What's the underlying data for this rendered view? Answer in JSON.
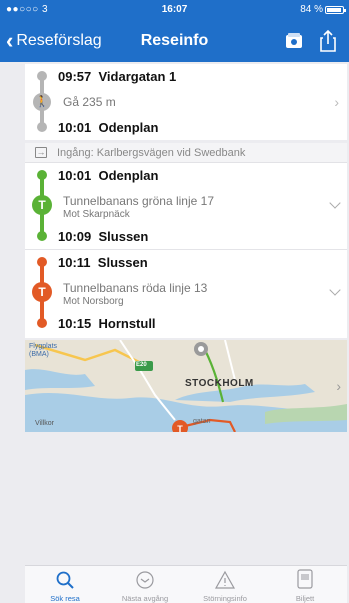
{
  "status_bar": {
    "carrier": "●●○○○ 3",
    "time": "16:07",
    "battery": "84 %"
  },
  "nav": {
    "back_label": "Reseförslag",
    "title": "Reseinfo"
  },
  "walk_leg": {
    "start_time": "09:57",
    "start_place": "Vidargatan 1",
    "distance": "Gå 235 m",
    "end_time": "10:01",
    "end_place": "Odenplan"
  },
  "entrance": "Ingång: Karlbergsvägen vid Swedbank",
  "legs": [
    {
      "badge": "T",
      "color": "#5ab236",
      "dep_time": "10:01",
      "dep_place": "Odenplan",
      "line": "Tunnelbanans gröna linje 17",
      "direction": "Mot Skarpnäck",
      "arr_time": "10:09",
      "arr_place": "Slussen"
    },
    {
      "badge": "T",
      "color": "#e25a26",
      "dep_time": "10:11",
      "dep_place": "Slussen",
      "line": "Tunnelbanans röda linje 13",
      "direction": "Mot Norsborg",
      "arr_time": "10:15",
      "arr_place": "Hornstull"
    }
  ],
  "map": {
    "label_airport": "Flygplats (BMA)",
    "label_city": "STOCKHOLM",
    "label_road": "E20",
    "label_villkor": "Villkor",
    "label_street": "gatan"
  },
  "tabs": [
    {
      "label": "Sök resa",
      "icon": "search-icon",
      "active": true
    },
    {
      "label": "Nästa avgång",
      "icon": "clock-icon",
      "active": false
    },
    {
      "label": "Störningsinfo",
      "icon": "warning-icon",
      "active": false
    },
    {
      "label": "Biljett",
      "icon": "ticket-icon",
      "active": false
    }
  ],
  "colors": {
    "primary": "#1f6fc9",
    "green_line": "#5ab236",
    "red_line": "#e25a26",
    "walk": "#b5b5b5"
  }
}
